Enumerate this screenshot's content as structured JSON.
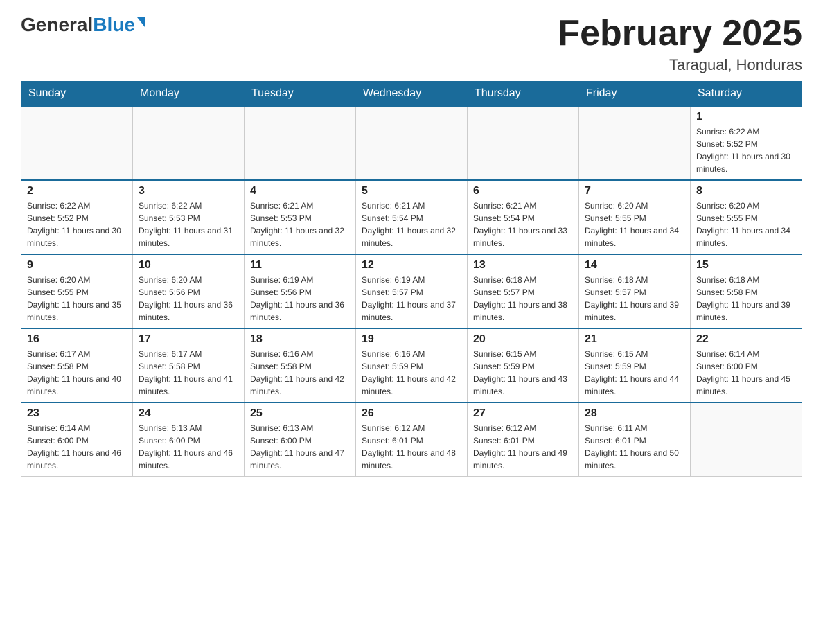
{
  "header": {
    "logo_general": "General",
    "logo_blue": "Blue",
    "month_title": "February 2025",
    "location": "Taragual, Honduras"
  },
  "days_of_week": [
    "Sunday",
    "Monday",
    "Tuesday",
    "Wednesday",
    "Thursday",
    "Friday",
    "Saturday"
  ],
  "weeks": [
    [
      {
        "day": "",
        "info": ""
      },
      {
        "day": "",
        "info": ""
      },
      {
        "day": "",
        "info": ""
      },
      {
        "day": "",
        "info": ""
      },
      {
        "day": "",
        "info": ""
      },
      {
        "day": "",
        "info": ""
      },
      {
        "day": "1",
        "info": "Sunrise: 6:22 AM\nSunset: 5:52 PM\nDaylight: 11 hours and 30 minutes."
      }
    ],
    [
      {
        "day": "2",
        "info": "Sunrise: 6:22 AM\nSunset: 5:52 PM\nDaylight: 11 hours and 30 minutes."
      },
      {
        "day": "3",
        "info": "Sunrise: 6:22 AM\nSunset: 5:53 PM\nDaylight: 11 hours and 31 minutes."
      },
      {
        "day": "4",
        "info": "Sunrise: 6:21 AM\nSunset: 5:53 PM\nDaylight: 11 hours and 32 minutes."
      },
      {
        "day": "5",
        "info": "Sunrise: 6:21 AM\nSunset: 5:54 PM\nDaylight: 11 hours and 32 minutes."
      },
      {
        "day": "6",
        "info": "Sunrise: 6:21 AM\nSunset: 5:54 PM\nDaylight: 11 hours and 33 minutes."
      },
      {
        "day": "7",
        "info": "Sunrise: 6:20 AM\nSunset: 5:55 PM\nDaylight: 11 hours and 34 minutes."
      },
      {
        "day": "8",
        "info": "Sunrise: 6:20 AM\nSunset: 5:55 PM\nDaylight: 11 hours and 34 minutes."
      }
    ],
    [
      {
        "day": "9",
        "info": "Sunrise: 6:20 AM\nSunset: 5:55 PM\nDaylight: 11 hours and 35 minutes."
      },
      {
        "day": "10",
        "info": "Sunrise: 6:20 AM\nSunset: 5:56 PM\nDaylight: 11 hours and 36 minutes."
      },
      {
        "day": "11",
        "info": "Sunrise: 6:19 AM\nSunset: 5:56 PM\nDaylight: 11 hours and 36 minutes."
      },
      {
        "day": "12",
        "info": "Sunrise: 6:19 AM\nSunset: 5:57 PM\nDaylight: 11 hours and 37 minutes."
      },
      {
        "day": "13",
        "info": "Sunrise: 6:18 AM\nSunset: 5:57 PM\nDaylight: 11 hours and 38 minutes."
      },
      {
        "day": "14",
        "info": "Sunrise: 6:18 AM\nSunset: 5:57 PM\nDaylight: 11 hours and 39 minutes."
      },
      {
        "day": "15",
        "info": "Sunrise: 6:18 AM\nSunset: 5:58 PM\nDaylight: 11 hours and 39 minutes."
      }
    ],
    [
      {
        "day": "16",
        "info": "Sunrise: 6:17 AM\nSunset: 5:58 PM\nDaylight: 11 hours and 40 minutes."
      },
      {
        "day": "17",
        "info": "Sunrise: 6:17 AM\nSunset: 5:58 PM\nDaylight: 11 hours and 41 minutes."
      },
      {
        "day": "18",
        "info": "Sunrise: 6:16 AM\nSunset: 5:58 PM\nDaylight: 11 hours and 42 minutes."
      },
      {
        "day": "19",
        "info": "Sunrise: 6:16 AM\nSunset: 5:59 PM\nDaylight: 11 hours and 42 minutes."
      },
      {
        "day": "20",
        "info": "Sunrise: 6:15 AM\nSunset: 5:59 PM\nDaylight: 11 hours and 43 minutes."
      },
      {
        "day": "21",
        "info": "Sunrise: 6:15 AM\nSunset: 5:59 PM\nDaylight: 11 hours and 44 minutes."
      },
      {
        "day": "22",
        "info": "Sunrise: 6:14 AM\nSunset: 6:00 PM\nDaylight: 11 hours and 45 minutes."
      }
    ],
    [
      {
        "day": "23",
        "info": "Sunrise: 6:14 AM\nSunset: 6:00 PM\nDaylight: 11 hours and 46 minutes."
      },
      {
        "day": "24",
        "info": "Sunrise: 6:13 AM\nSunset: 6:00 PM\nDaylight: 11 hours and 46 minutes."
      },
      {
        "day": "25",
        "info": "Sunrise: 6:13 AM\nSunset: 6:00 PM\nDaylight: 11 hours and 47 minutes."
      },
      {
        "day": "26",
        "info": "Sunrise: 6:12 AM\nSunset: 6:01 PM\nDaylight: 11 hours and 48 minutes."
      },
      {
        "day": "27",
        "info": "Sunrise: 6:12 AM\nSunset: 6:01 PM\nDaylight: 11 hours and 49 minutes."
      },
      {
        "day": "28",
        "info": "Sunrise: 6:11 AM\nSunset: 6:01 PM\nDaylight: 11 hours and 50 minutes."
      },
      {
        "day": "",
        "info": ""
      }
    ]
  ]
}
